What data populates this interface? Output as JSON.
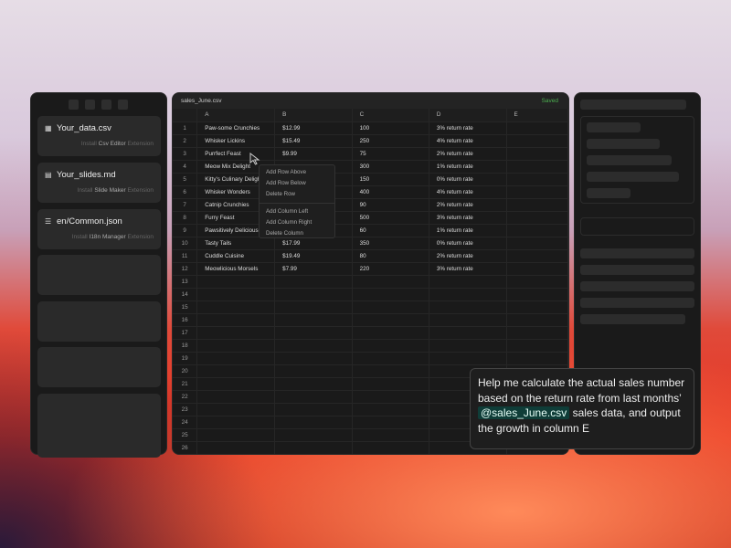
{
  "left_panel": {
    "cards": [
      {
        "icon": "grid-icon",
        "title": "Your_data.csv",
        "install": "Install",
        "ext_name": "Csv Editor",
        "ext": "Extension"
      },
      {
        "icon": "slides-icon",
        "title": "Your_slides.md",
        "install": "Install",
        "ext_name": "Slide Maker",
        "ext": "Extension"
      },
      {
        "icon": "list-icon",
        "title": "en/Common.json",
        "install": "Install",
        "ext_name": "I18n Manager",
        "ext": "Extension"
      }
    ]
  },
  "sheet": {
    "filename": "sales_June.csv",
    "status": "Saved",
    "columns": [
      "A",
      "B",
      "C",
      "D",
      "E"
    ],
    "rows": [
      [
        "Paw-some Crunchies",
        "$12.99",
        "100",
        "3% return rate",
        ""
      ],
      [
        "Whisker Lickins",
        "$15.49",
        "250",
        "4% return rate",
        ""
      ],
      [
        "Purrfect Feast",
        "$9.99",
        "75",
        "2% return rate",
        ""
      ],
      [
        "Meow Mix Delight",
        "",
        "300",
        "1% return rate",
        ""
      ],
      [
        "Kitty's Culinary Delight",
        "",
        "150",
        "0% return rate",
        ""
      ],
      [
        "Whisker Wonders",
        "",
        "400",
        "4% return rate",
        ""
      ],
      [
        "Catnip Crunchies",
        "",
        "90",
        "2% return rate",
        ""
      ],
      [
        "Furry Feast",
        "",
        "500",
        "3% return rate",
        ""
      ],
      [
        "Pawsitively Delicious",
        "",
        "60",
        "1% return rate",
        ""
      ],
      [
        "Tasty Tails",
        "$17.99",
        "350",
        "0% return rate",
        ""
      ],
      [
        "Cuddle Cuisine",
        "$19.49",
        "80",
        "2% return rate",
        ""
      ],
      [
        "Meowlicious Morsels",
        "$7.99",
        "220",
        "3% return rate",
        ""
      ]
    ],
    "total_rows": 26
  },
  "context_menu": {
    "items": [
      "Add Row Above",
      "Add Row Below",
      "Delete Row",
      "Add Column Left",
      "Add Column Right",
      "Delete Column"
    ]
  },
  "prompt": {
    "before": "Help me calculate the actual sales number based on the return rate from last months’ ",
    "mention": "@sales_June.csv",
    "after": " sales data, and output the growth in column E"
  },
  "colors": {
    "accent_saved": "#4caf50",
    "mention_bg": "#0f3d38"
  }
}
